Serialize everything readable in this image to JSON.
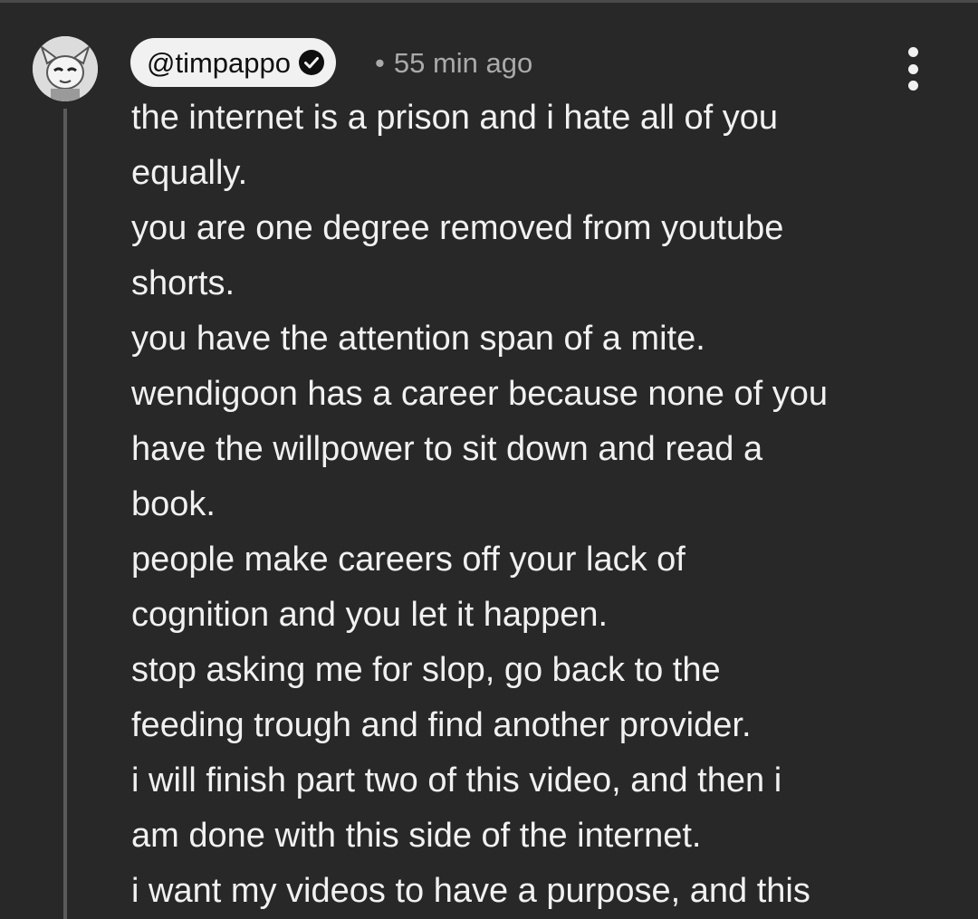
{
  "comment": {
    "author": "@timpappo",
    "verified_icon": "verified-check-icon",
    "separator": "•",
    "timestamp": "55 min ago",
    "more_icon": "vertical-dots-icon",
    "lines": [
      "the internet is a prison and i hate all of you",
      "equally.",
      "you are one degree removed from youtube",
      "shorts.",
      "you have the attention span of a mite.",
      "wendigoon has a career because none of you",
      "have the willpower to sit down and read a",
      "book.",
      "people make careers off your lack of",
      "cognition and you let it happen.",
      "stop asking me for slop, go back to the",
      "feeding trough and find another provider.",
      "i will finish part two of this video, and then i",
      "am done with this side of the internet.",
      "i want my videos to have a purpose, and this"
    ]
  },
  "colors": {
    "background": "#282828",
    "text": "#f1f1f1",
    "meta": "#aaaaaa",
    "chip": "#f1f1f1"
  }
}
